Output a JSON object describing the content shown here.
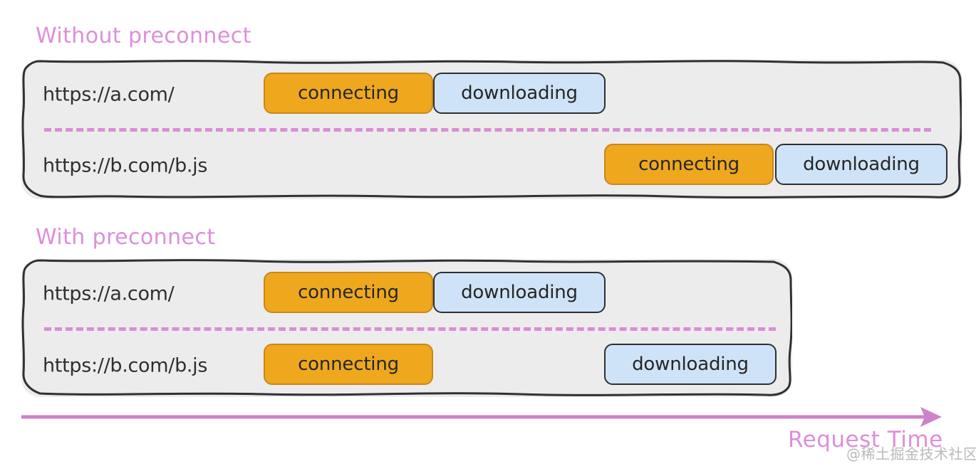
{
  "sections": [
    {
      "title": "Without preconnect",
      "rows": [
        {
          "url": "https://a.com/",
          "phases": [
            {
              "label": "connecting",
              "type": "connecting"
            },
            {
              "label": "downloading",
              "type": "downloading"
            }
          ]
        },
        {
          "url": "https://b.com/b.js",
          "phases": [
            {
              "label": "connecting",
              "type": "connecting"
            },
            {
              "label": "downloading",
              "type": "downloading"
            }
          ]
        }
      ]
    },
    {
      "title": "With preconnect",
      "rows": [
        {
          "url": "https://a.com/",
          "phases": [
            {
              "label": "connecting",
              "type": "connecting"
            },
            {
              "label": "downloading",
              "type": "downloading"
            }
          ]
        },
        {
          "url": "https://b.com/b.js",
          "phases": [
            {
              "label": "connecting",
              "type": "connecting"
            },
            {
              "label": "downloading",
              "type": "downloading"
            }
          ]
        }
      ]
    }
  ],
  "axis": {
    "label": "Request Time"
  },
  "watermark": "@稀土掘金技术社区",
  "colors": {
    "accent_pink": "#dd8fd8",
    "connecting_fill": "#efa81e",
    "connecting_border": "#c8871a",
    "downloading_fill": "#cfe3f8",
    "downloading_border": "#2d2f33",
    "panel_fill": "#ececec",
    "panel_border": "#2f3136",
    "text": "#2f2f2f",
    "watermark": "#b9b9b9"
  }
}
